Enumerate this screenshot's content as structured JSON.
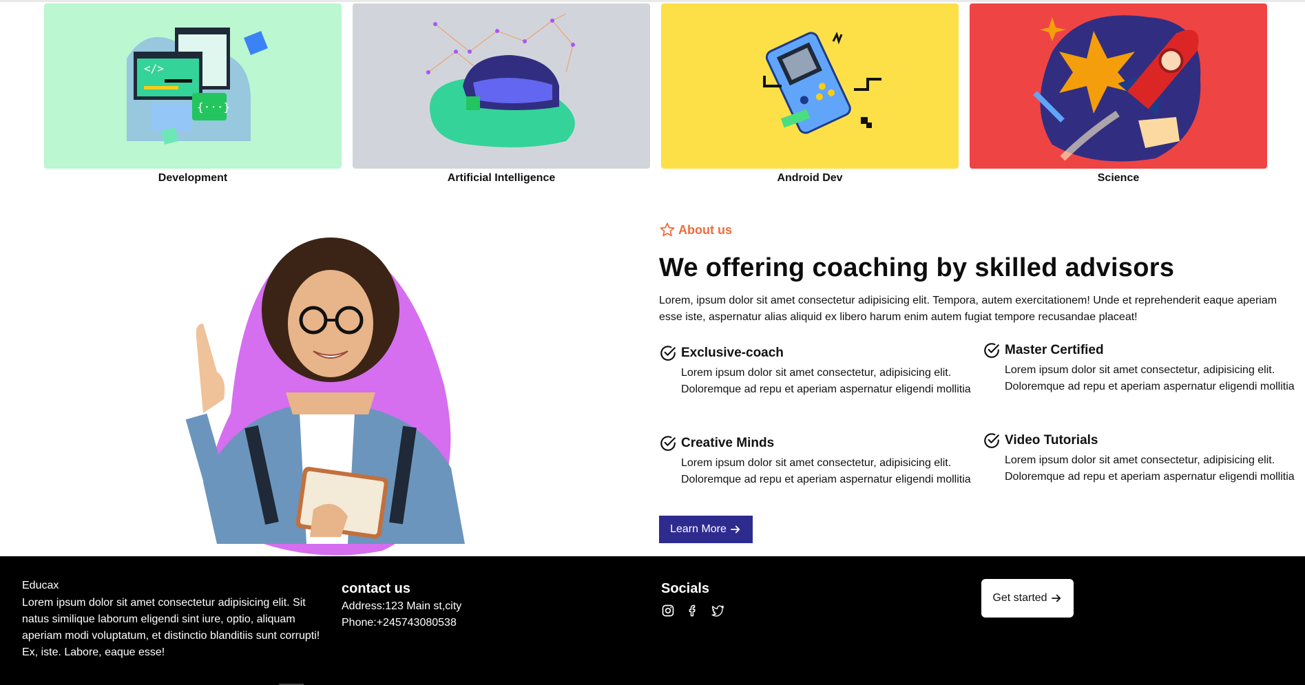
{
  "categories": [
    {
      "label": "Development",
      "bg": "#bbf7d0",
      "icon": "code-window-illustration"
    },
    {
      "label": "Artificial Intelligence",
      "bg": "#d1d5db",
      "icon": "vr-headset-illustration"
    },
    {
      "label": "Android Dev",
      "bg": "#fde047",
      "icon": "handheld-game-illustration"
    },
    {
      "label": "Science",
      "bg": "#ef4444",
      "icon": "rocket-illustration"
    }
  ],
  "about": {
    "tag": "About us",
    "title": "We offering coaching by skilled advisors",
    "description": "Lorem, ipsum dolor sit amet consectetur adipisicing elit. Tempora, autem exercitationem! Unde et reprehenderit eaque aperiam esse iste, aspernatur alias aliquid ex libero harum enim autem fugiat tempore recusandae placeat!",
    "features": [
      {
        "title": "Exclusive-coach",
        "text": "Lorem ipsum dolor sit amet consectetur, adipisicing elit. Doloremque ad repu et aperiam aspernatur eligendi mollitia"
      },
      {
        "title": "Master Certified",
        "text": "Lorem ipsum dolor sit amet consectetur, adipisicing elit. Doloremque ad repu et aperiam aspernatur eligendi mollitia"
      },
      {
        "title": "Creative Minds",
        "text": "Lorem ipsum dolor sit amet consectetur, adipisicing elit. Doloremque ad repu et aperiam aspernatur eligendi mollitia"
      },
      {
        "title": "Video Tutorials",
        "text": "Lorem ipsum dolor sit amet consectetur, adipisicing elit. Doloremque ad repu et aperiam aspernatur eligendi mollitia"
      }
    ],
    "button_label": "Learn More"
  },
  "footer": {
    "brand": "Educax",
    "about": "Lorem ipsum dolor sit amet consectetur adipisicing elit. Sit natus similique laborum eligendi sint iure, optio, aliquam aperiam modi voluptatum, et distinctio blanditiis sunt corrupti! Ex, iste. Labore, eaque esse!",
    "contact_heading": "contact us",
    "address": "Address:123 Main st,city",
    "phone": "Phone:+245743080538",
    "socials_heading": "Socials",
    "social_icons": [
      "instagram-icon",
      "facebook-icon",
      "twitter-icon"
    ],
    "cta_label": "Get started"
  },
  "colors": {
    "accent": "#ef6c3a",
    "button": "#2e2b8f",
    "portrait_blob": "#d66ef0",
    "footer_bg": "#000000"
  }
}
